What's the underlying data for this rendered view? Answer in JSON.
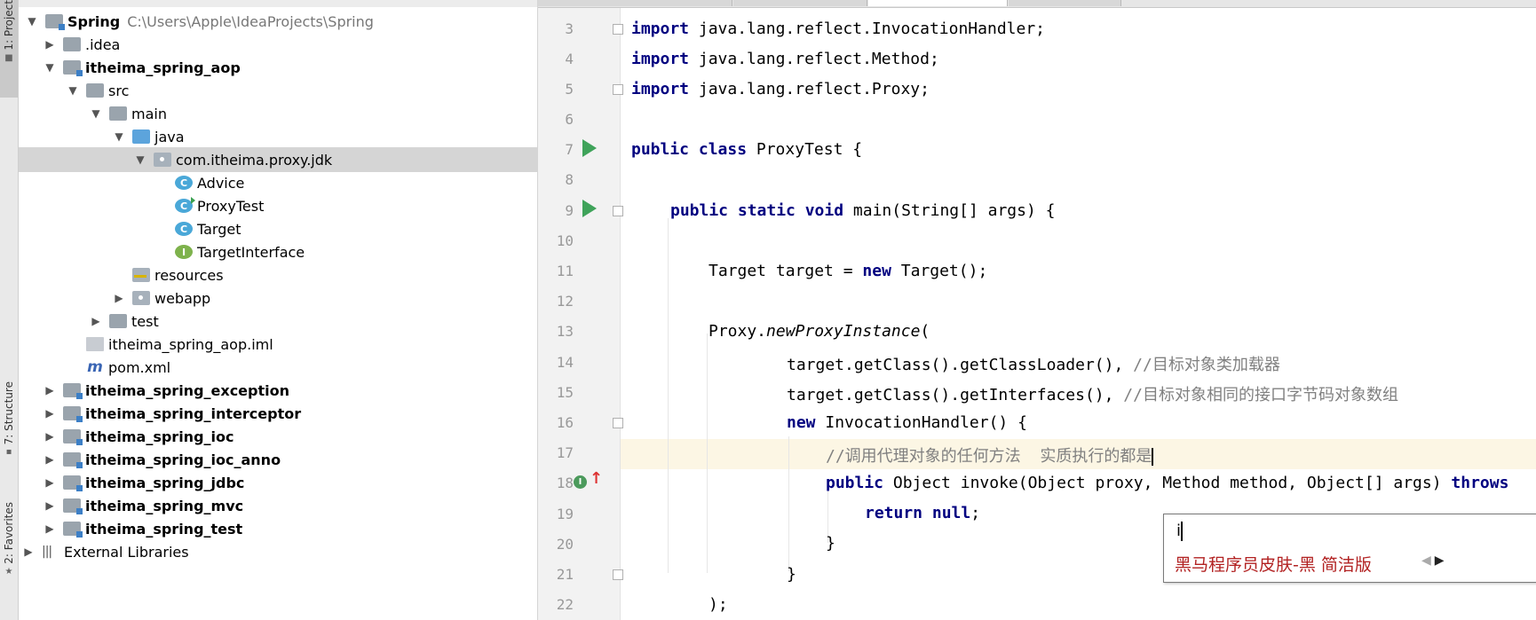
{
  "toolstrip": {
    "project_tab": "1: Project",
    "structure_tab": "7: Structure",
    "favorites_tab": "2: Favorites"
  },
  "project_tree": {
    "root_name": "Spring",
    "root_path": "C:\\Users\\Apple\\IdeaProjects\\Spring",
    "idea": ".idea",
    "module_aop": "itheima_spring_aop",
    "src": "src",
    "main": "main",
    "java": "java",
    "package": "com.itheima.proxy.jdk",
    "class_advice": "Advice",
    "class_proxytest": "ProxyTest",
    "class_target": "Target",
    "iface_target": "TargetInterface",
    "resources": "resources",
    "webapp": "webapp",
    "test": "test",
    "iml": "itheima_spring_aop.iml",
    "pom": "pom.xml",
    "modules": [
      "itheima_spring_exception",
      "itheima_spring_interceptor",
      "itheima_spring_ioc",
      "itheima_spring_ioc_anno",
      "itheima_spring_jdbc",
      "itheima_spring_mvc",
      "itheima_spring_test"
    ],
    "external_libraries": "External Libraries"
  },
  "editor": {
    "line_numbers": [
      "3",
      "4",
      "5",
      "6",
      "7",
      "8",
      "9",
      "10",
      "11",
      "12",
      "13",
      "14",
      "15",
      "16",
      "17",
      "18",
      "19",
      "20",
      "21",
      "22"
    ],
    "code": {
      "l3_kw": "import",
      "l3_rest": " java.lang.reflect.InvocationHandler;",
      "l4_kw": "import",
      "l4_rest": " java.lang.reflect.Method;",
      "l5_kw": "import",
      "l5_rest": " java.lang.reflect.Proxy;",
      "l7_kw": "public class",
      "l7_rest": " ProxyTest {",
      "l9_kw": "public static void",
      "l9_rest": " main(String[] args) {",
      "l11_pre": "Target target = ",
      "l11_kw": "new",
      "l11_post": " Target();",
      "l13_pre": "Proxy.",
      "l13_it": "newProxyInstance",
      "l13_post": "(",
      "l14_code": "target.getClass().getClassLoader(), ",
      "l14_cm": "//目标对象类加载器",
      "l15_code": "target.getClass().getInterfaces(), ",
      "l15_cm": "//目标对象相同的接口字节码对象数组",
      "l16_kw": "new",
      "l16_rest": " InvocationHandler() {",
      "l17_cm": "//调用代理对象的任何方法  实质执行的都是",
      "l18_kw": "public",
      "l18_mid": " Object invoke(Object proxy, Method method, Object[] args) ",
      "l18_kw2": "throws",
      "l19_kw": "return null",
      "l19_post": ";",
      "l20": "}",
      "l21": "}",
      "l22": ");"
    }
  },
  "ime": {
    "input": "i",
    "candidate": "黑马程序员皮肤-黑  简洁版",
    "prev": "◀",
    "next": "▶"
  }
}
